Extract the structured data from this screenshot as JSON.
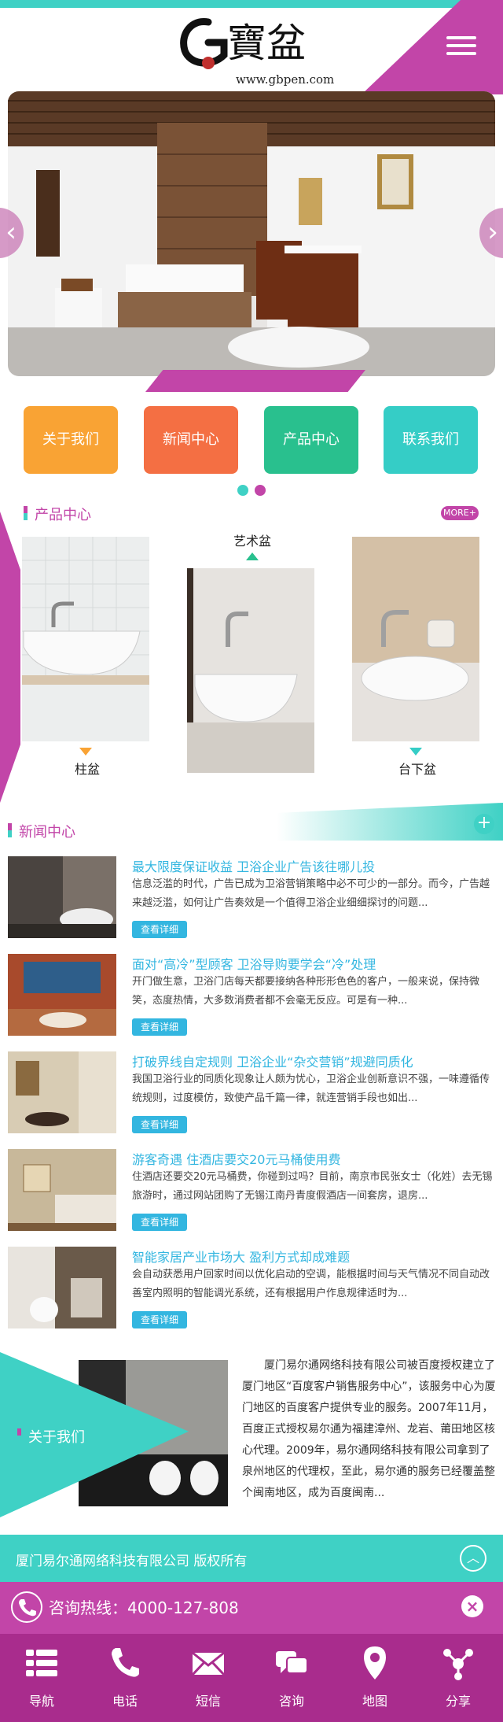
{
  "header": {
    "logo_alt": "G寶盆",
    "logo_url_text": "www.gbpen.com"
  },
  "banner": {
    "prev_symbol": "‹",
    "next_symbol": "›"
  },
  "quick_links": [
    {
      "label": "关于我们",
      "color": "#f9a334"
    },
    {
      "label": "新闻中心",
      "color": "#f46f43"
    },
    {
      "label": "产品中心",
      "color": "#29c08e"
    },
    {
      "label": "联系我们",
      "color": "#35cdc6"
    }
  ],
  "products": {
    "title": "产品中心",
    "more": "MORE+",
    "items": [
      {
        "label": "柱盆"
      },
      {
        "label": "艺术盆"
      },
      {
        "label": "台下盆"
      }
    ]
  },
  "news": {
    "title": "新闻中心",
    "add_symbol": "+",
    "button_label": "查看详细",
    "items": [
      {
        "title": "最大限度保证收益 卫浴企业广告该往哪儿投",
        "desc": "信息泛滥的时代，广告已成为卫浴营销策略中必不可少的一部分。而今，广告越来越泛滥，如何让广告奏效是一个值得卫浴企业细细探讨的问题..."
      },
      {
        "title": "面对“高冷”型顾客 卫浴导购要学会“冷”处理",
        "desc": "开门做生意，卫浴门店每天都要接纳各种形形色色的客户，一般来说，保持微笑，态度热情，大多数消费者都不会毫无反应。可是有一种..."
      },
      {
        "title": "打破界线自定规则 卫浴企业“杂交营销”规避同质化",
        "desc": "我国卫浴行业的同质化现象让人颇为忧心，卫浴企业创新意识不强，一味遵循传统规则，过度模仿，致使产品千篇一律，就连营销手段也如出..."
      },
      {
        "title": "游客奇遇 住酒店要交20元马桶使用费",
        "desc": "住酒店还要交20元马桶费，你碰到过吗？目前，南京市民张女士（化姓）去无锡旅游时，通过网站团购了无锡江南丹青度假酒店一间套房，退房..."
      },
      {
        "title": "智能家居产业市场大 盈利方式却成难题",
        "desc": "会自动获悉用户回家时间以优化启动的空调，能根据时间与天气情况不同自动改善室内照明的智能调光系统，还有根据用户作息规律适时为..."
      }
    ]
  },
  "about": {
    "title": "关于我们",
    "text": "厦门易尔通网络科技有限公司被百度授权建立了厦门地区“百度客户销售服务中心”，该服务中心为厦门地区的百度客户提供专业的服务。2007年11月，百度正式授权易尔通为福建漳州、龙岩、莆田地区核心代理。2009年，易尔通网络科技有限公司拿到了泉州地区的代理权，至此，易尔通的服务已经覆盖整个闽南地区，成为百度闽南..."
  },
  "footer": {
    "copyright": "厦门易尔通网络科技有限公司 版权所有",
    "up_symbol": "︿",
    "hotline": "咨询热线：4000-127-808",
    "close_symbol": "×"
  },
  "bottom_nav": [
    {
      "label": "导航",
      "icon": "menu-icon"
    },
    {
      "label": "电话",
      "icon": "phone-icon"
    },
    {
      "label": "短信",
      "icon": "mail-icon"
    },
    {
      "label": "咨询",
      "icon": "chat-icon"
    },
    {
      "label": "地图",
      "icon": "map-pin-icon"
    },
    {
      "label": "分享",
      "icon": "share-icon"
    }
  ]
}
